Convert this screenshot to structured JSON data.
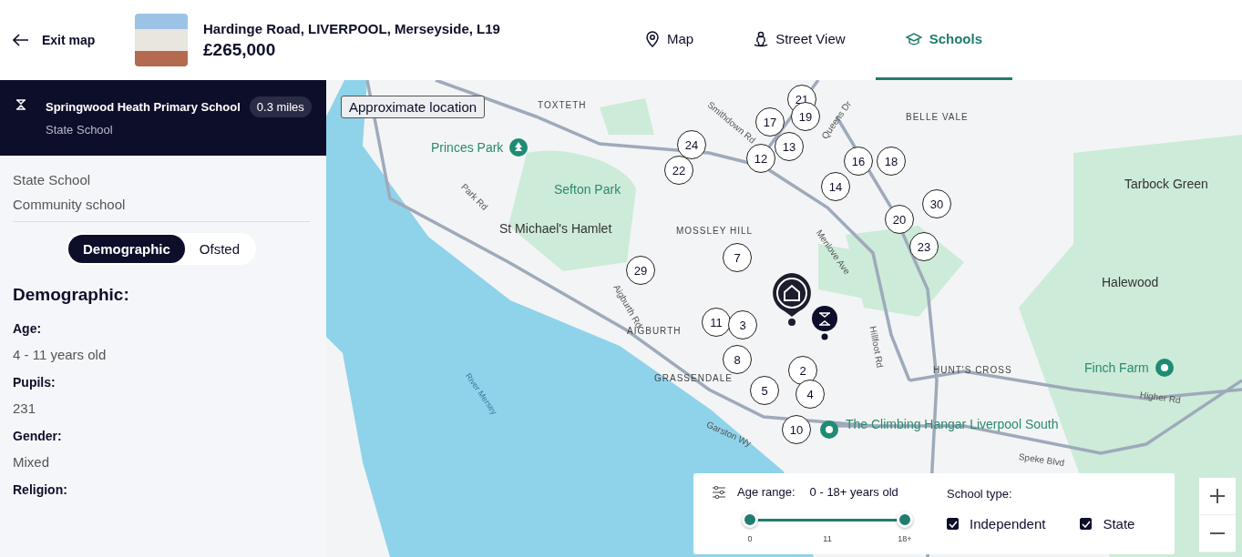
{
  "header": {
    "exit_label": "Exit map",
    "address": "Hardinge Road, LIVERPOOL, Merseyside, L19",
    "price": "£265,000"
  },
  "tabs": [
    {
      "label": "Map",
      "kind": "pin",
      "selected": false
    },
    {
      "label": "Street View",
      "kind": "person",
      "selected": false
    },
    {
      "label": "Schools",
      "kind": "cap",
      "selected": true
    }
  ],
  "school": {
    "name": "Springwood Heath Primary School",
    "distance": "0.3 miles",
    "type": "State School"
  },
  "details": {
    "lines": [
      "State School",
      "Community school"
    ],
    "toggle": [
      {
        "label": "Demographic",
        "selected": true
      },
      {
        "label": "Ofsted",
        "selected": false
      }
    ],
    "heading": "Demographic:",
    "fields": [
      {
        "label": "Age:",
        "value": "4 - 11 years old"
      },
      {
        "label": "Pupils:",
        "value": "231"
      },
      {
        "label": "Gender:",
        "value": "Mixed"
      },
      {
        "label": "Religion:"
      }
    ]
  },
  "map": {
    "notice": "Approximate location",
    "labels": [
      {
        "text": "TOXTETH",
        "kind": "district"
      },
      {
        "text": "Princes Park",
        "kind": "park"
      },
      {
        "text": "Sefton Park",
        "kind": "park"
      },
      {
        "text": "St Michael's Hamlet",
        "kind": "place"
      },
      {
        "text": "MOSSLEY HILL",
        "kind": "district"
      },
      {
        "text": "BELLE VALE",
        "kind": "district"
      },
      {
        "text": "Tarbock Green",
        "kind": "place"
      },
      {
        "text": "Halewood",
        "kind": "place"
      },
      {
        "text": "AIGBURTH",
        "kind": "district"
      },
      {
        "text": "GRASSENDALE",
        "kind": "district"
      },
      {
        "text": "HUNT'S CROSS",
        "kind": "district"
      },
      {
        "text": "Finch Farm",
        "kind": "park"
      },
      {
        "text": "The Climbing Hangar Liverpool South",
        "kind": "park"
      },
      {
        "text": "River Mersey",
        "kind": "water"
      },
      {
        "text": "Smithdown Rd",
        "kind": "road"
      },
      {
        "text": "Park Rd",
        "kind": "road"
      },
      {
        "text": "Queens Dr",
        "kind": "road"
      },
      {
        "text": "Menlove Ave",
        "kind": "road"
      },
      {
        "text": "Aigburth Rd",
        "kind": "road"
      },
      {
        "text": "Hillfoot Rd",
        "kind": "road"
      },
      {
        "text": "Garston Wy",
        "kind": "road"
      },
      {
        "text": "Higher Rd",
        "kind": "road"
      },
      {
        "text": "Speke Blvd",
        "kind": "road"
      }
    ],
    "pins": [
      "21",
      "19",
      "17",
      "13",
      "24",
      "12",
      "22",
      "16",
      "18",
      "14",
      "30",
      "20",
      "23",
      "7",
      "29",
      "11",
      "3",
      "8",
      "2",
      "5",
      "4",
      "10"
    ]
  },
  "filter": {
    "age_label": "Age range:",
    "age_value": "0 - 18+ years old",
    "level": 1,
    "ticks": [
      "0",
      "11",
      "18+"
    ],
    "type_label": "School type:",
    "types": [
      {
        "label": "Independent",
        "checked": true
      },
      {
        "label": "State",
        "checked": true
      }
    ]
  }
}
